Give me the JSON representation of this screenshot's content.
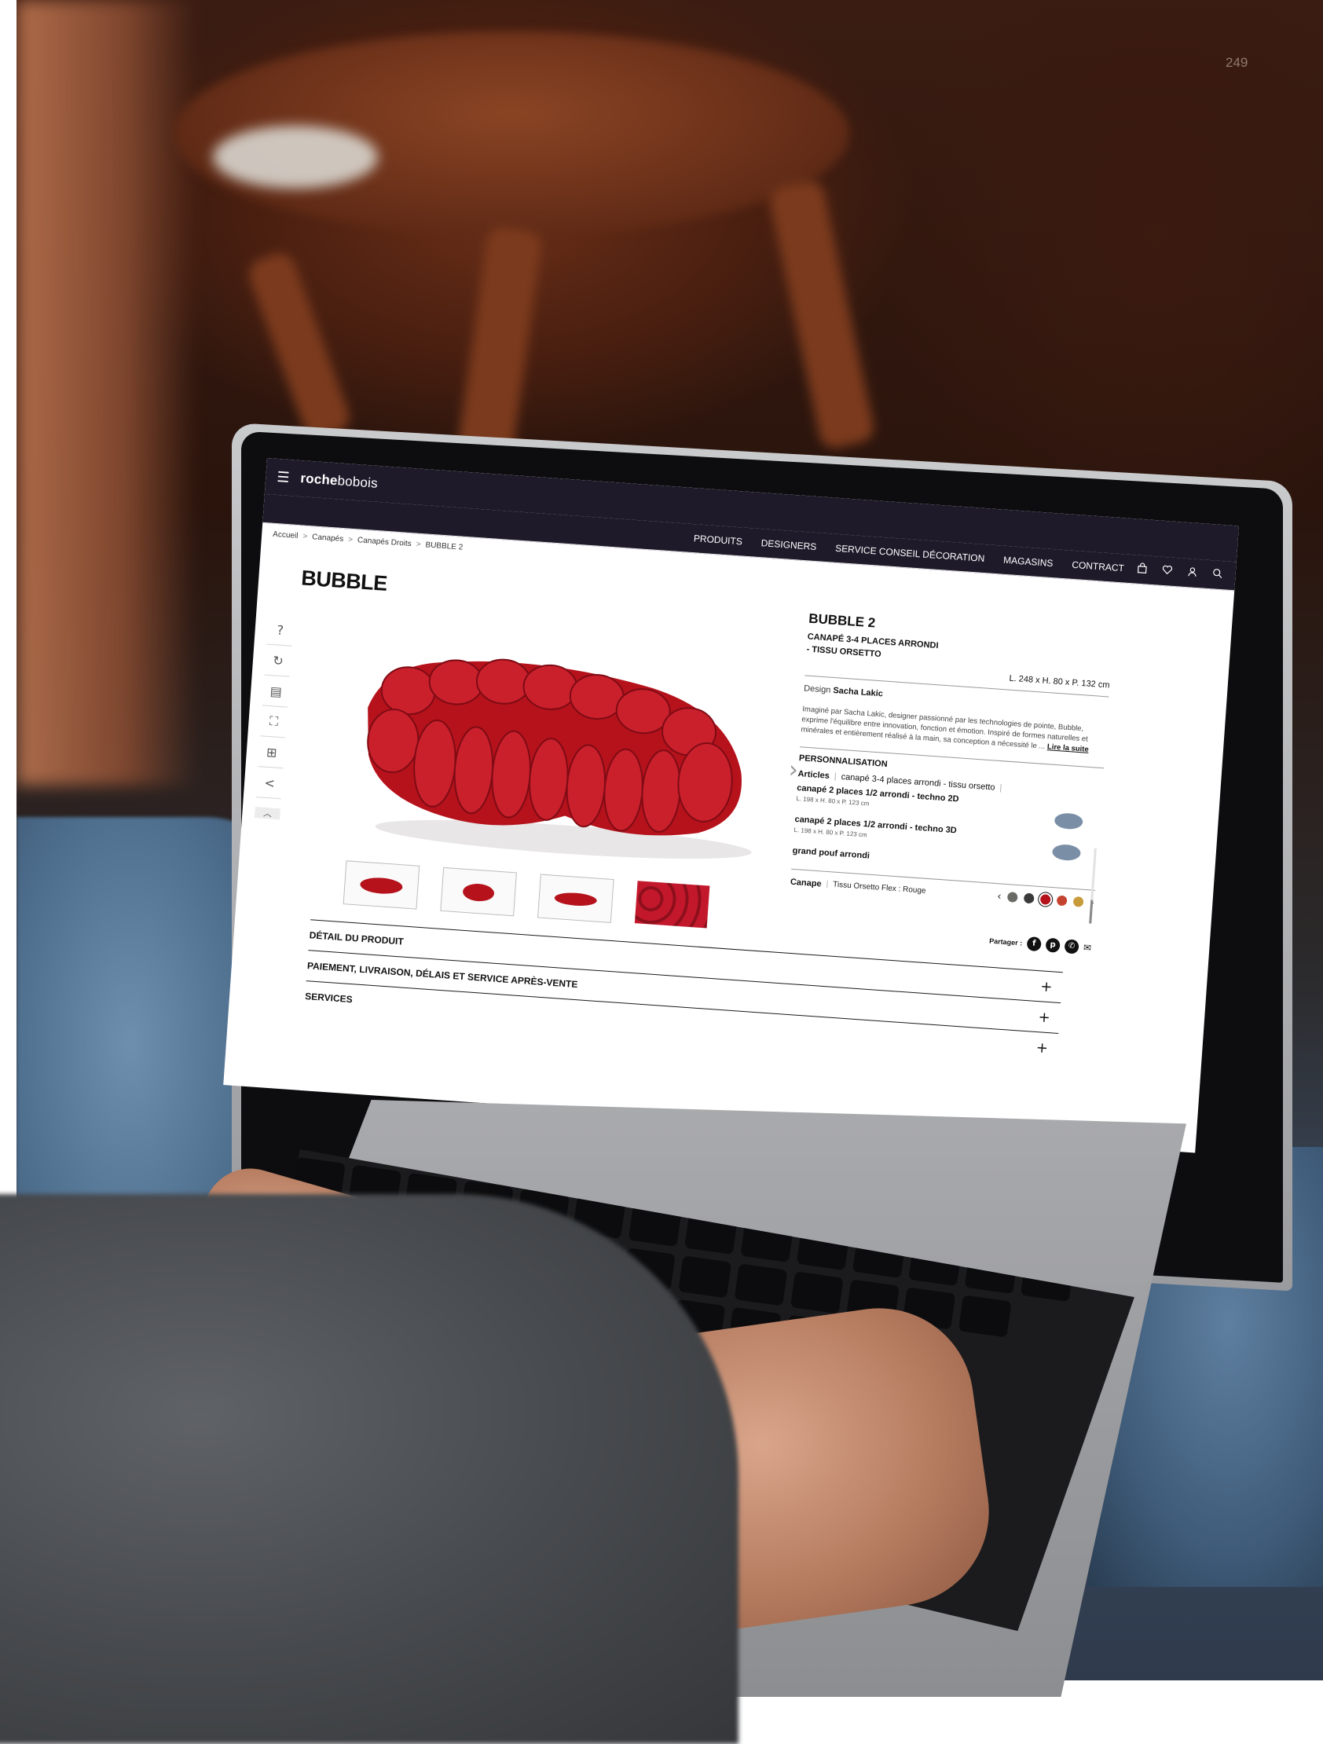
{
  "page_number": "249",
  "site": {
    "logo_bold": "roche",
    "logo_light": "bobois",
    "nav": [
      "PRODUITS",
      "DESIGNERS",
      "SERVICE CONSEIL DÉCORATION",
      "MAGASINS",
      "CONTRACT"
    ],
    "icons": [
      "bag-icon",
      "heart-icon",
      "user-icon",
      "search-icon"
    ]
  },
  "breadcrumbs": [
    "Accueil",
    "Canapés",
    "Canapés Droits",
    "BUBBLE 2"
  ],
  "page_title": "BUBBLE",
  "tools": [
    "help-icon",
    "rotate-icon",
    "catalog-icon",
    "fullscreen-icon",
    "grid-icon",
    "share-icon"
  ],
  "product": {
    "name": "BUBBLE 2",
    "subtitle_line1": "CANAPÉ 3-4 PLACES ARRONDI",
    "subtitle_line2": "- TISSU ORSETTO",
    "dimensions": "L. 248 x H. 80 x P. 132 cm",
    "designer_prefix": "Design",
    "designer_name": "Sacha Lakic",
    "description": "Imaginé par Sacha Lakic, designer passionné par les technologies de pointe, Bubble, exprime l'équilibre entre innovation, fonction et émotion. Inspiré de formes naturelles et minérales et entièrement réalisé à la main, sa conception a nécessité le ...",
    "read_more": "Lire la suite",
    "personalisation_title": "PERSONNALISATION",
    "articles_label": "Articles",
    "articles_current": "canapé 3-4 places arrondi - tissu orsetto",
    "variants": [
      {
        "name": "canapé 2 places 1/2 arrondi - techno 2D",
        "dims": "L. 198 x H. 80 x P. 123 cm"
      },
      {
        "name": "canapé 2 places 1/2 arrondi - techno 3D",
        "dims": "L. 198 x H. 80 x P. 123 cm"
      },
      {
        "name": "grand pouf arrondi",
        "dims": ""
      }
    ],
    "fabric_label": "Canape",
    "fabric_value": "Tissu Orsetto Flex : Rouge",
    "swatch_colors": [
      "#6b6b66",
      "#3a3a3a",
      "#b5121b",
      "#c4432f",
      "#c79a3a"
    ],
    "selected_swatch": 2,
    "share_label": "Partager :"
  },
  "accordion": [
    "DÉTAIL DU PRODUIT",
    "PAIEMENT, LIVRAISON, DÉLAIS ET SERVICE APRÈS-VENTE",
    "SERVICES"
  ],
  "colors": {
    "sofa_red": "#b5121b",
    "topbar": "#1f1a2a"
  }
}
